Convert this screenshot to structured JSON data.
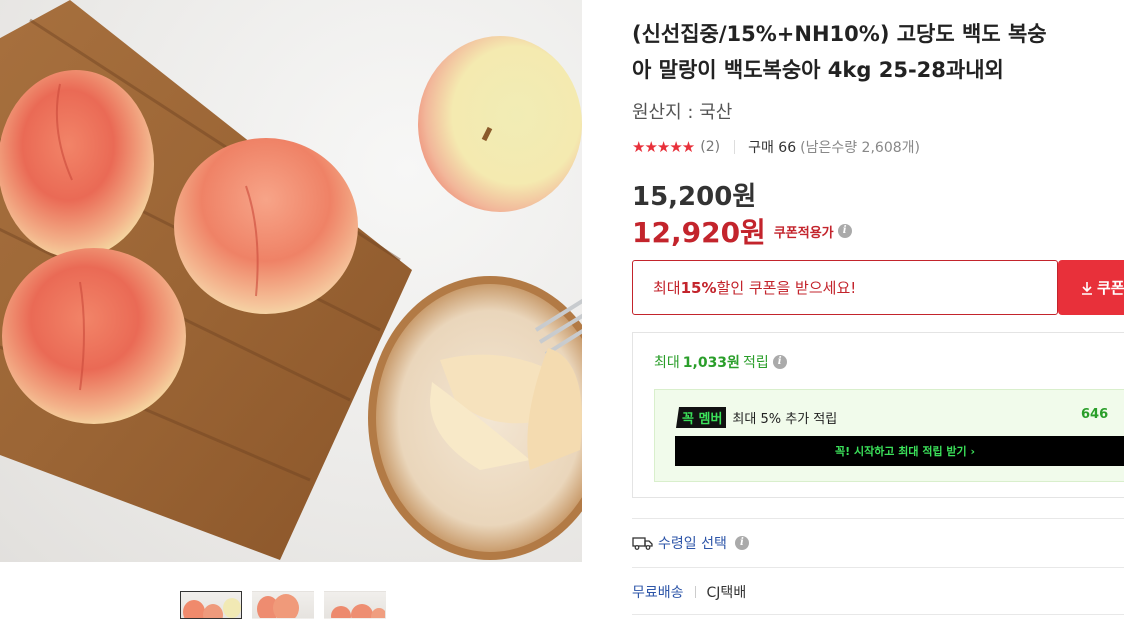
{
  "product": {
    "title_line1": "(신선집중/15%+NH10%) 고당도 백도 복숭",
    "title_line2": "아 말랑이 백도복숭아 4kg 25-28과내외",
    "origin": "원산지 : 국산",
    "rating_stars": "★★★★★",
    "rating_value": 5,
    "review_count": "(2)",
    "purchase": "구매 66",
    "stock": "(남은수량 2,608개)"
  },
  "price": {
    "original": "15,200원",
    "sale": "12,920원",
    "coupon_apply": "쿠폰적용가",
    "info_icon": "i"
  },
  "coupon": {
    "text_prefix": "최대 ",
    "text_percent": "15%",
    "text_suffix": " 할인 쿠폰을 받으세요!",
    "button_label": "쿠폰",
    "button_icon": "download-icon"
  },
  "points": {
    "prefix": "최대",
    "amount": "1,033원",
    "suffix": "적립",
    "member_logo": "꼭",
    "member_name": "멤버",
    "member_text": "최대 5% 추가 적립",
    "member_extra": "646",
    "member_cta": "꼭! 시작하고 최대 적립 받기 ›"
  },
  "delivery": {
    "select_label": "수령일 선택",
    "ship_free": "무료배송",
    "courier": "CJ택배"
  },
  "colors": {
    "accent_red": "#c3242c",
    "coupon_button": "#e8303a",
    "points_green": "#2a9e2a",
    "member_green": "#3be15a",
    "link_blue": "#2d55a8"
  }
}
